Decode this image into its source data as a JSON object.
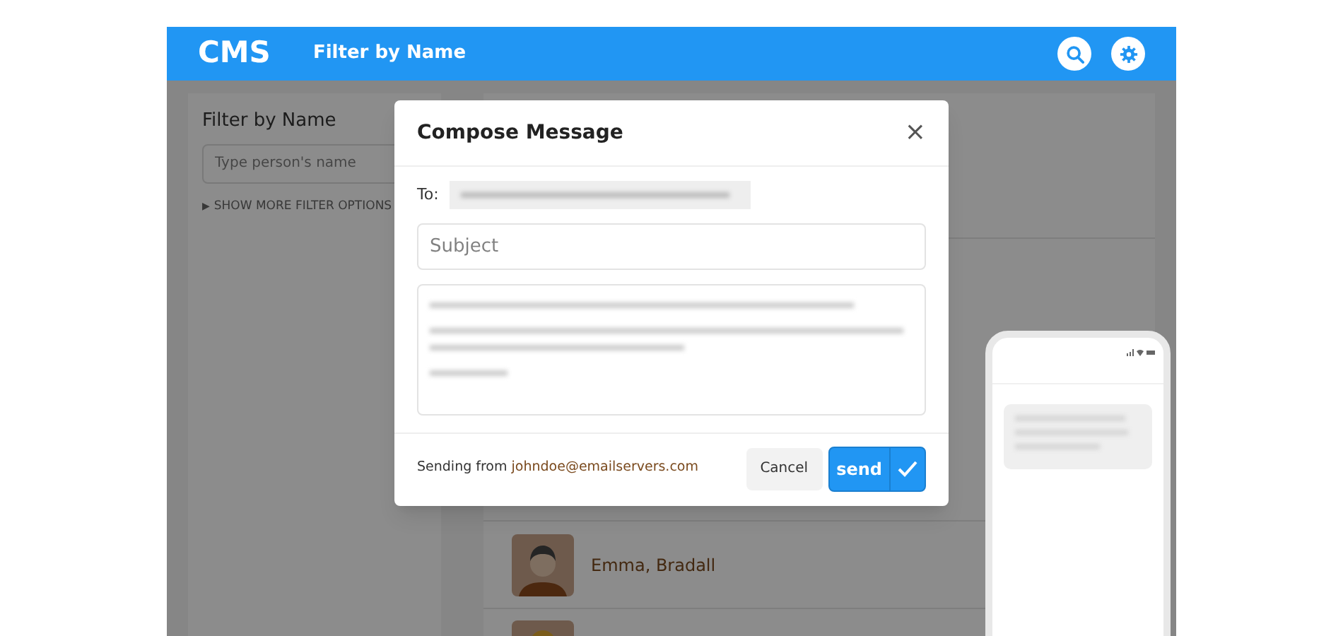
{
  "header": {
    "logo": "CMS",
    "title": "Filter by Name"
  },
  "filter_panel": {
    "title": "Filter by Name",
    "search": {
      "placeholder": "Type person's name"
    },
    "more_options": {
      "arrow": "▶",
      "label": "SHOW MORE FILTER OPTIONS",
      "expanded": false
    }
  },
  "people": [
    {
      "kind": "person",
      "name": "Emma, Bradall"
    },
    {
      "kind": "cut_off"
    }
  ],
  "compose_dialog": {
    "title": "Compose Message",
    "close": "×",
    "to_label": "To:",
    "subject": {
      "placeholder": "Subject"
    },
    "sender_label": "Sending from",
    "sender_email": "johndoe@emailservers.com",
    "buttons": {
      "cancel": "Cancel",
      "send": "send"
    }
  }
}
